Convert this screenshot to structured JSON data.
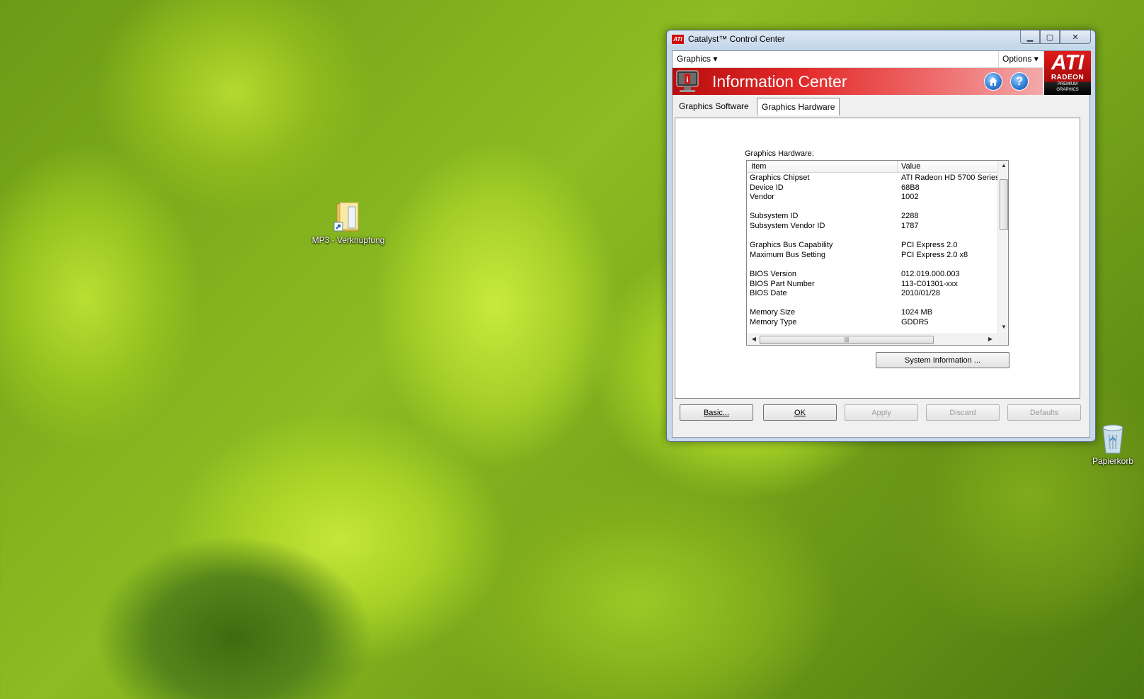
{
  "desktop": {
    "shortcut_label": "MP3 - Verknüpfung",
    "recycle_bin_label": "Papierkorb"
  },
  "window": {
    "title": "Catalyst™ Control Center",
    "title_logo": "ATI",
    "controls": {
      "minimize": "▁",
      "maximize": "▢",
      "close": "✕"
    }
  },
  "menubar": {
    "graphics_label": "Graphics ▾",
    "options_label": "Options ▾"
  },
  "header": {
    "title": "Information Center",
    "home_icon": "home-icon",
    "help_icon": "help-icon",
    "help_glyph": "?"
  },
  "badge": {
    "brand": "ATI",
    "line1": "RADEON",
    "line2": "PREMIUM",
    "line3": "GRAPHICS",
    "color": "#d20a0a"
  },
  "tabs": [
    {
      "label": "Graphics Software",
      "active": false
    },
    {
      "label": "Graphics Hardware",
      "active": true
    }
  ],
  "panel": {
    "section_label": "Graphics Hardware:",
    "columns": [
      "Item",
      "Value"
    ],
    "rows": [
      [
        "Graphics Chipset",
        "ATI Radeon HD 5700 Series"
      ],
      [
        "Device ID",
        "68B8"
      ],
      [
        "Vendor",
        "1002"
      ],
      [
        "",
        ""
      ],
      [
        "Subsystem ID",
        "2288"
      ],
      [
        "Subsystem Vendor ID",
        "1787"
      ],
      [
        "",
        ""
      ],
      [
        "Graphics Bus Capability",
        "PCI Express 2.0"
      ],
      [
        "Maximum Bus Setting",
        "PCI Express 2.0 x8"
      ],
      [
        "",
        ""
      ],
      [
        "BIOS Version",
        "012.019.000.003"
      ],
      [
        "BIOS Part Number",
        "113-C01301-xxx"
      ],
      [
        "BIOS Date",
        "2010/01/28"
      ],
      [
        "",
        ""
      ],
      [
        "Memory Size",
        "1024 MB"
      ],
      [
        "Memory Type",
        "GDDR5"
      ]
    ],
    "system_info_button": "System Information ..."
  },
  "footer": {
    "basic": "Basic...",
    "ok": "OK",
    "apply": "Apply",
    "discard": "Discard",
    "defaults": "Defaults"
  }
}
